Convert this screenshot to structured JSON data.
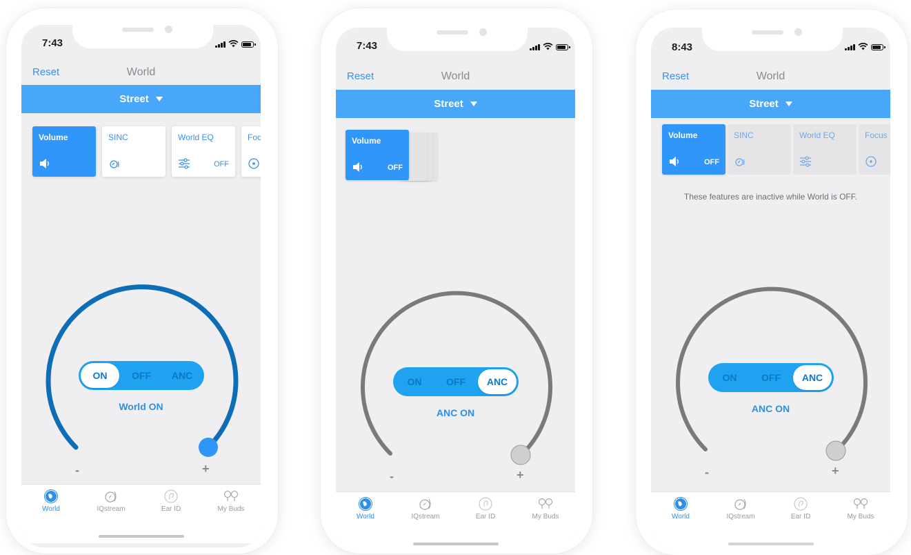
{
  "colors": {
    "accent": "#3196fa",
    "dial_active": "#0e6db5",
    "dial_inactive": "#7a7a7a"
  },
  "tabs_common": {
    "world": "World",
    "iqstream": "IQstream",
    "earid": "Ear ID",
    "mybuds": "My Buds"
  },
  "phones": [
    {
      "time": "7:43",
      "nav": {
        "left": "Reset",
        "title": "World"
      },
      "preset": "Street",
      "cards": {
        "volume": "Volume",
        "volume_off": "",
        "sinc": "SINC",
        "world_eq": "World EQ",
        "world_eq_off": "OFF",
        "focus": "Foc"
      },
      "toggle": {
        "on": "ON",
        "off": "OFF",
        "anc": "ANC",
        "selected": "ON"
      },
      "state": "World ON",
      "dial": {
        "minus": "-",
        "plus": "+",
        "level": 1.0
      }
    },
    {
      "time": "7:43",
      "nav": {
        "left": "Reset",
        "title": "World"
      },
      "preset": "Street",
      "cards": {
        "volume": "Volume",
        "volume_off": "OFF"
      },
      "toggle": {
        "on": "ON",
        "off": "OFF",
        "anc": "ANC",
        "selected": "ANC"
      },
      "state": "ANC ON",
      "dial": {
        "minus": "-",
        "plus": "+",
        "level": 1.0
      }
    },
    {
      "time": "8:43",
      "nav": {
        "left": "Reset",
        "title": "World"
      },
      "preset": "Street",
      "cards": {
        "volume": "Volume",
        "volume_off": "OFF",
        "sinc": "SINC",
        "world_eq": "World EQ",
        "focus": "Focus"
      },
      "notice": "These features are inactive while World is OFF.",
      "toggle": {
        "on": "ON",
        "off": "OFF",
        "anc": "ANC",
        "selected": "ANC"
      },
      "state": "ANC ON",
      "dial": {
        "minus": "-",
        "plus": "+",
        "level": 1.0
      }
    }
  ]
}
